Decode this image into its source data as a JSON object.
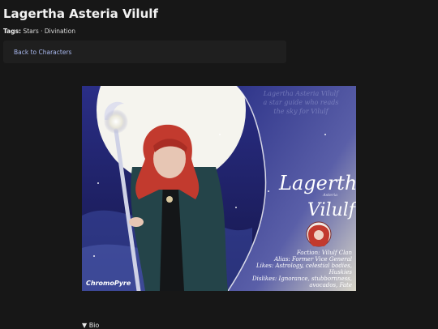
{
  "page": {
    "title": "Lagertha Asteria Vilulf",
    "tags_label": "Tags:",
    "tags": [
      "Stars",
      "Divination"
    ],
    "tag_separator": "·",
    "back_link": "Back to Characters",
    "bio_toggle": "▼ Bio"
  },
  "artwork": {
    "name_line1": "Lagertha",
    "name_small": "Asteria",
    "name_line2": "Vilulf",
    "watermark": "ChromoPyre",
    "faded_text": [
      "Lagertha Asteria Vilulf",
      "a star guide who reads",
      "the sky for Vilulf"
    ],
    "info": [
      "Faction: Vilulf Clan",
      "Alias: Former Vice General",
      "Likes: Astrology, celestial bodies,",
      "Huskies",
      "Dislikes: Ignorance, stubbornness,",
      "avocados, Fate"
    ]
  },
  "colors": {
    "background": "#171717",
    "link": "#a9b8ee",
    "art_sky": "#1d1f6b",
    "moon": "#f5f4ee",
    "hair": "#c23a2e"
  }
}
